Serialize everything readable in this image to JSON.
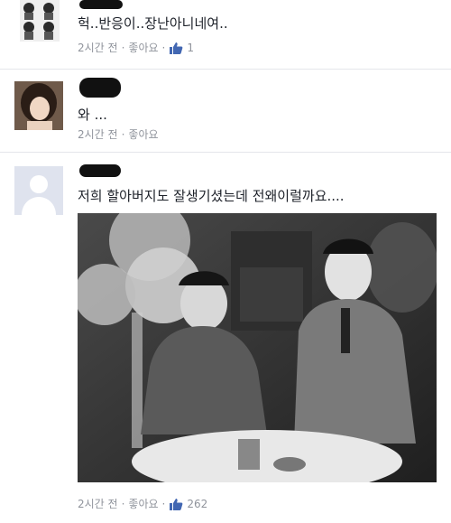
{
  "comments": [
    {
      "text": "헉..반응이..장난아니네여..",
      "time": "2시간 전",
      "like_label": "좋아요",
      "like_count": "1"
    },
    {
      "text": "와 ...",
      "time": "2시간 전",
      "like_label": "좋아요",
      "like_count": ""
    },
    {
      "text": "저희 할아버지도 잘생기셨는데 전왜이럴까요....",
      "time": "2시간 전",
      "like_label": "좋아요",
      "like_count": "262"
    }
  ],
  "separator": "·",
  "icons": {
    "like": "thumbs-up-icon",
    "default_avatar": "default-user-icon"
  },
  "colors": {
    "text": "#1d2129",
    "meta": "#90949c",
    "like_blue": "#4267b2",
    "divider": "#e4e6eb"
  }
}
